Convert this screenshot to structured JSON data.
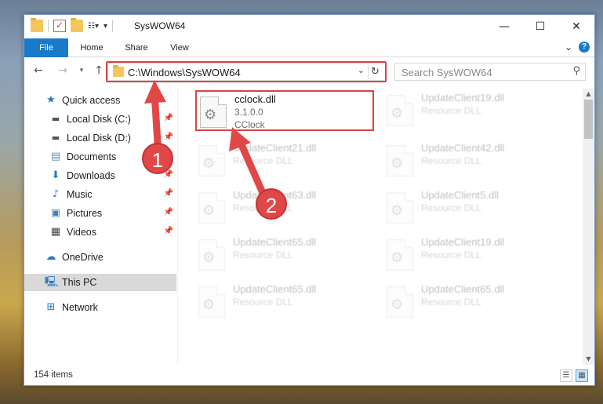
{
  "window": {
    "title": "SysWOW64",
    "controls": {
      "minimize": "—",
      "maximize": "☐",
      "close": "✕"
    }
  },
  "ribbon": {
    "tabs": [
      "File",
      "Home",
      "Share",
      "View"
    ]
  },
  "nav": {
    "address": "C:\\Windows\\SysWOW64",
    "search_placeholder": "Search SysWOW64"
  },
  "sidebar": {
    "items": [
      {
        "label": "Quick access",
        "icon": "star-icon"
      },
      {
        "label": "Local Disk (C:)",
        "icon": "drive-icon",
        "pinned": true
      },
      {
        "label": "Local Disk (D:)",
        "icon": "drive-icon",
        "pinned": true
      },
      {
        "label": "Documents",
        "icon": "documents-icon",
        "pinned": true
      },
      {
        "label": "Downloads",
        "icon": "download-icon",
        "pinned": true
      },
      {
        "label": "Music",
        "icon": "music-icon",
        "pinned": true
      },
      {
        "label": "Pictures",
        "icon": "pictures-icon",
        "pinned": true
      },
      {
        "label": "Videos",
        "icon": "video-icon",
        "pinned": true
      },
      {
        "label": "OneDrive",
        "icon": "cloud-icon"
      },
      {
        "label": "This PC",
        "icon": "computer-icon"
      },
      {
        "label": "Network",
        "icon": "network-icon"
      }
    ]
  },
  "files": [
    {
      "name": "cclock.dll",
      "line2": "3.1.0.0",
      "line3": "CClock"
    },
    {
      "name": "UpdateClient19.dll",
      "line2": "Resource DLL"
    },
    {
      "name": "UpdateClient21.dll",
      "line2": "Resource DLL"
    },
    {
      "name": "UpdateClient42.dll",
      "line2": "Resource DLL"
    },
    {
      "name": "UpdateClient63.dll",
      "line2": "Resource DLL"
    },
    {
      "name": "UpdateClient5.dll",
      "line2": "Resource DLL"
    },
    {
      "name": "UpdateClient65.dll",
      "line2": "Resource DLL"
    },
    {
      "name": "UpdateClient19.dll",
      "line2": "Resource DLL"
    },
    {
      "name": "UpdateClient65.dll",
      "line2": "Resource DLL"
    },
    {
      "name": "UpdateClient65.dll",
      "line2": "Resource DLL"
    }
  ],
  "status": {
    "count": "154 items"
  },
  "annotations": {
    "step1": "1",
    "step2": "2"
  },
  "colors": {
    "accent": "#1979ca",
    "highlight": "#d94545",
    "annotation": "#e04848"
  }
}
